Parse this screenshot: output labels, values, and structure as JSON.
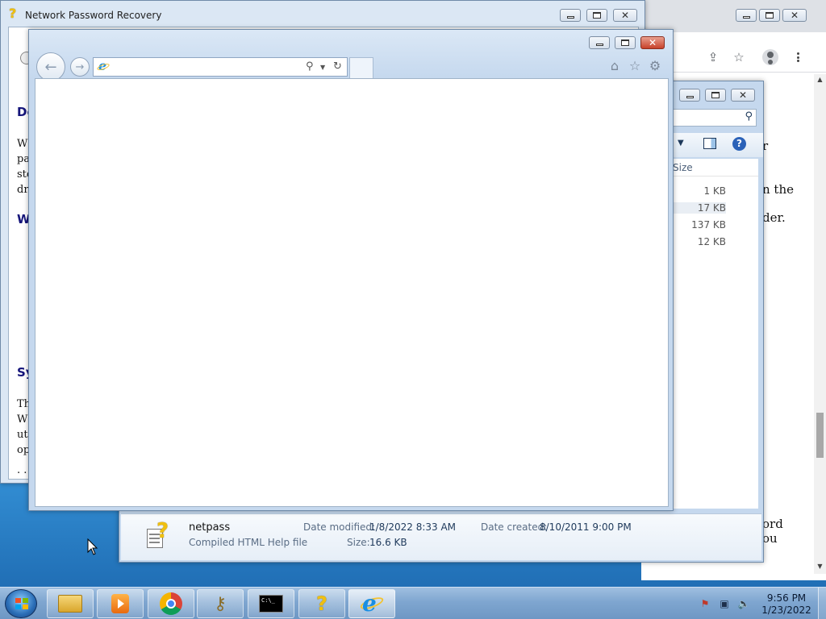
{
  "chrome": {
    "fragments": [
      "r",
      "n the",
      "der.",
      "ord",
      "ou"
    ]
  },
  "explorer": {
    "column_size": "Size",
    "sizes": [
      "1 KB",
      "17 KB",
      "137 KB",
      "12 KB"
    ],
    "details": {
      "name": "netpass",
      "type": "Compiled HTML Help file",
      "date_modified_label": "Date modified:",
      "date_modified": "1/8/2022 8:33 AM",
      "date_created_label": "Date created:",
      "date_created": "8/10/2011 9:00 PM",
      "size_label": "Size:",
      "size": "16.6 KB"
    }
  },
  "help": {
    "title": "Network Password Recovery",
    "heading_fragments": [
      "De",
      "W",
      "Sy"
    ],
    "text_fragments_1": [
      "W",
      "pa",
      "sto",
      "dri"
    ],
    "text_fragments_2": [
      "Th",
      "W",
      "uti",
      "op"
    ],
    "trailing": ". ."
  },
  "ie": {
    "address_value": "",
    "address_placeholder": ""
  },
  "taskbar": {
    "time": "9:56 PM",
    "date": "1/23/2022"
  }
}
